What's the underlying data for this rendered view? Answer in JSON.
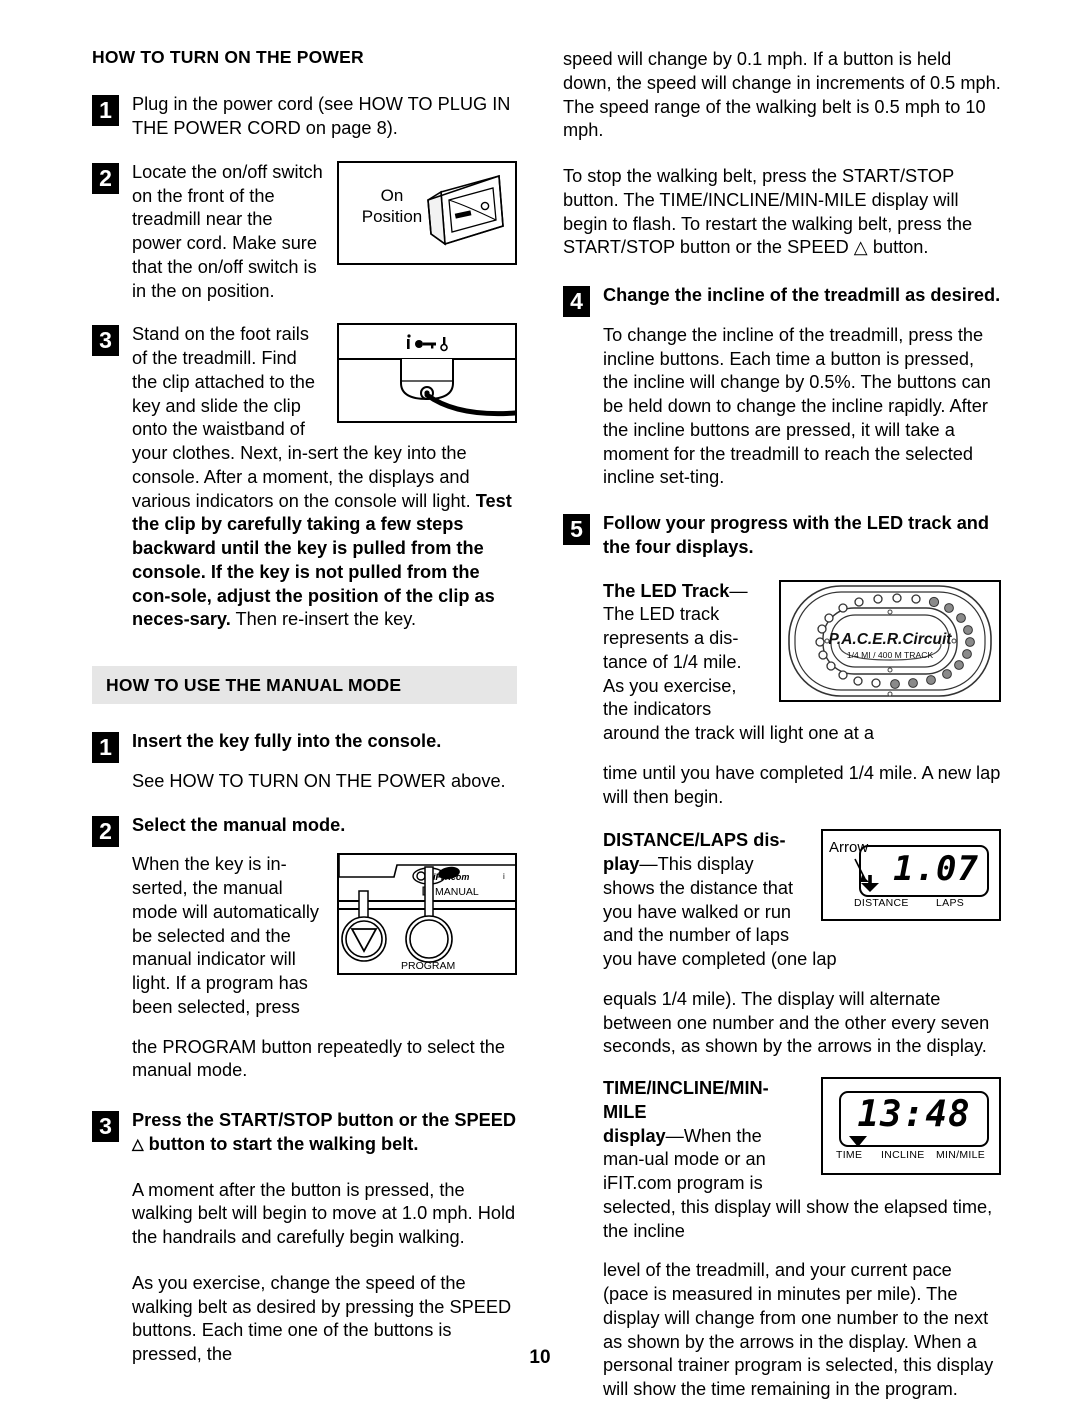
{
  "page": {
    "number": "10"
  },
  "left_column": {
    "section1": {
      "title": "HOW TO TURN ON THE POWER",
      "steps": [
        {
          "num": "1",
          "text": "Plug in the power cord (see HOW TO PLUG IN THE POWER CORD on page 8)."
        },
        {
          "num": "2",
          "text": "Locate the on/off switch on the front of the treadmill near the power cord. Make sure that the on/off switch is in the on position."
        },
        {
          "num": "3",
          "text_a": "Stand on the foot rails of the treadmill. Find the clip attached to the key and slide the clip onto the waistband of your clothes. Next, in-sert the key into the console. After a moment, the displays and various indicators on the console will light. ",
          "text_bold": "Test the clip by carefully taking a few steps backward until the key is pulled from the console. If the key is not pulled from the con-sole, adjust the position of the clip as neces-sary.",
          "text_b": " Then re-insert the key."
        }
      ],
      "figure_switch": {
        "label_line1": "On",
        "label_line2": "Position",
        "name": "on-off-switch-illustration"
      },
      "figure_key": {
        "name": "key-clip-console-illustration"
      }
    },
    "section2": {
      "title": "HOW TO USE THE MANUAL MODE",
      "steps": [
        {
          "num": "1",
          "heading": "Insert the key fully into the console.",
          "body": "See HOW TO TURN ON THE POWER above."
        },
        {
          "num": "2",
          "heading": "Select the manual mode.",
          "body_a": "When the key is in-serted, the manual mode will automatically be selected and the manual indicator will light. If a program has been selected, press",
          "body_b": "the PROGRAM button repeatedly to select the manual mode."
        },
        {
          "num": "3",
          "heading_a": "Press the START/STOP button or the SPEED ",
          "heading_tri": "△",
          "heading_b": " button to start the walking belt.",
          "body_a": "A moment after the button is pressed, the walking belt will begin to move at 1.0 mph. Hold the handrails and carefully begin walking.",
          "body_b": "As you exercise, change the speed of the walking belt as desired by pressing the SPEED buttons. Each time one of the buttons is pressed, the"
        }
      ],
      "figure_console": {
        "logo": "iFIT.com",
        "manual_label": "MANUAL",
        "program_label": "PROGRAM",
        "name": "console-panel-illustration"
      }
    }
  },
  "right_column": {
    "continued_paragraphs": [
      "speed will change by 0.1 mph. If a button is held down, the speed will change in increments of 0.5 mph. The speed range of the walking belt is 0.5 mph to 10 mph.",
      "To stop the walking belt, press the START/STOP button. The TIME/INCLINE/MIN-MILE display will begin to flash. To restart the walking belt, press the START/STOP button or the SPEED △ button."
    ],
    "steps": [
      {
        "num": "4",
        "heading": "Change the incline of the treadmill as desired.",
        "body": "To change the incline of the treadmill, press the incline buttons. Each time a button is pressed, the incline will change by 0.5%. The buttons can be held down to change the incline rapidly. After the incline buttons are pressed, it will take a moment for the treadmill to reach the selected incline set-ting."
      },
      {
        "num": "5",
        "heading": "Follow your progress with the LED track and the four displays."
      }
    ],
    "led_track": {
      "label_bold": "The LED Track",
      "dash": "—",
      "body_a": "The LED track represents a dis-tance of 1/4 mile. As you exercise, the indicators around the track will light one at a",
      "body_b": "time until you have completed 1/4 mile. A new lap will then begin.",
      "figure": {
        "brand": "P.A.C.E.R.Circuit",
        "subtitle": "1/4 MI / 400 M TRACK",
        "name": "led-track-illustration"
      }
    },
    "distance_laps": {
      "label_bold_a": "DISTANCE/LAPS dis-",
      "label_bold_b": "play",
      "dash": "—",
      "body_a": "This display shows the distance that you have walked or run and the number of laps you have completed (one lap",
      "body_b": "equals 1/4 mile). The display will alternate between one number and the other every seven seconds, as shown by the arrows in the display.",
      "figure": {
        "arrow_label": "Arrow",
        "value": "1.07",
        "caption_left": "DISTANCE",
        "caption_right": "LAPS",
        "name": "distance-laps-display-illustration"
      }
    },
    "time_incline": {
      "label_bold_a": "TIME/INCLINE/MIN-MILE",
      "label_bold_b": "display",
      "dash": "—",
      "body_a": "When the man-ual mode or an iFIT.com program is selected, this display will show the elapsed time, the incline",
      "body_b": "level of the treadmill, and your current pace (pace is measured in minutes per mile). The display will change from one number to the next as shown by the arrows in the display. When a personal trainer program is selected, this display will show the time remaining in the program.",
      "figure": {
        "value": "13:48",
        "caption_time": "TIME",
        "caption_incline": "INCLINE",
        "caption_minmile": "MIN/MILE",
        "name": "time-incline-minmile-display-illustration"
      }
    }
  }
}
